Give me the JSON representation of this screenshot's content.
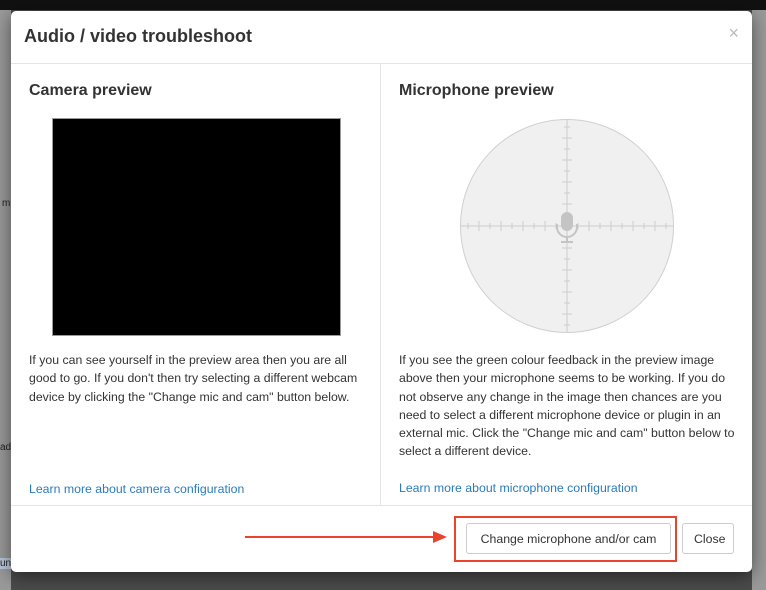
{
  "background": {
    "fragments": [
      "m",
      "ad",
      "un"
    ]
  },
  "dialog": {
    "title": "Audio / video troubleshoot",
    "close_glyph": "×"
  },
  "camera": {
    "heading": "Camera preview",
    "description": "If you can see yourself in the preview area then you are all good to go. If you don't then try selecting a different webcam device by clicking the \"Change mic and cam\" button below.",
    "link": "Learn more about camera configuration"
  },
  "microphone": {
    "heading": "Microphone preview",
    "description": "If you see the green colour feedback in the preview image above then your microphone seems to be working. If you do not observe any change in the image then chances are you need to select a different microphone device or plugin in an external mic. Click the \"Change mic and cam\" button below to select a different device.",
    "link": "Learn more about microphone configuration",
    "icon": "microphone-icon"
  },
  "footer": {
    "change_label": "Change microphone and/or cam",
    "close_label": "Close"
  },
  "colors": {
    "highlight": "#e8452c",
    "link": "#2a7bbf"
  }
}
